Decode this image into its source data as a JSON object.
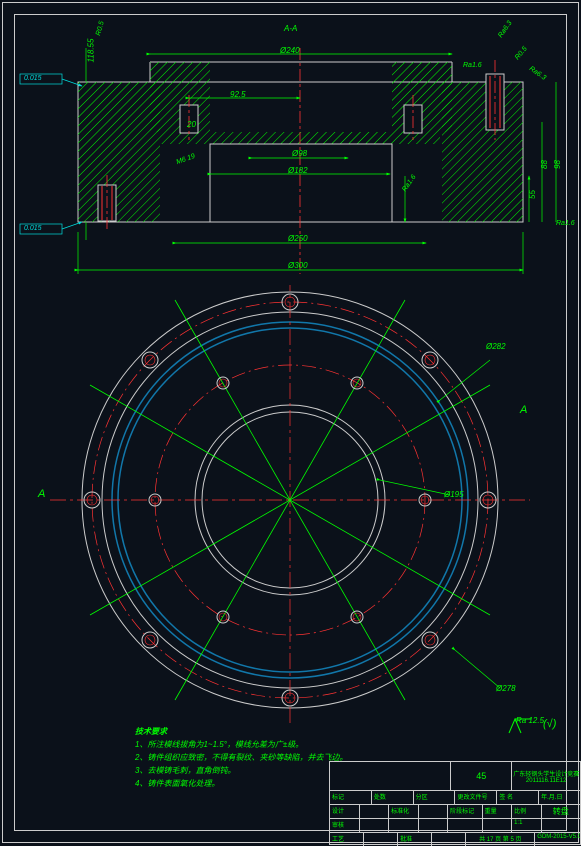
{
  "section_label": "A-A",
  "dims": {
    "d240": "Ø240",
    "d92_5": "92.5",
    "d98": "Ø98",
    "d182": "Ø182",
    "d250": "Ø250",
    "d300": "Ø300",
    "h55": "55",
    "h88": "88",
    "h98": "98",
    "h118_55": "118.55",
    "M6_19": "M6 19",
    "h20": "20",
    "R0_5_L": "R0.5",
    "R0_5_R": "R0.5",
    "Ra1_6_a": "Ra1.6",
    "Ra1_6_b": "Ra1.6",
    "Ra1_6_c": "Ra1.6",
    "Ra6_3": "Ra6.3",
    "Ra6_3b": "Ra6.3",
    "Ra3_2": "Ra3.2",
    "g0_015_75_28": "0.015",
    "g0_015_11_13_12": "0.015",
    "d282": "Ø282",
    "d195": "Ø195",
    "d278": "Ø278"
  },
  "marks": {
    "A1": "A",
    "A2": "A"
  },
  "surf_default": "(√)",
  "surf_val": "Ra 12.5",
  "notes_title": "技术要求",
  "notes": [
    "1、所注模线拔角为1~1.5°，模线允差为广±级。",
    "2、铸件组织应致密，不得有裂纹、夹砂等缺陷，并去飞边。",
    "3、去模铸毛刺，直角倒钝。",
    "4、铸件表面氧化处理。"
  ],
  "titleblock": {
    "material": "45",
    "project_top": "广东轻钢头学生设计竞赛",
    "project_num": "2011116.11E12",
    "dwg_name": "转盘",
    "row_hdr": [
      "标记",
      "处数",
      "分区",
      "更改文件号",
      "签 名",
      "年.月.日"
    ],
    "row_sign1": [
      "设计",
      "",
      "标准化",
      ""
    ],
    "row_sign2": [
      "审核",
      "",
      "",
      ""
    ],
    "row_sign3": [
      "工艺",
      "",
      "批准",
      ""
    ],
    "stage": "阶段标记",
    "weight": "重量",
    "scale": "比例",
    "scale_val": "1:1",
    "sheet": "共 17 页  第 5 页",
    "dwg_no": "GDM-2015-V5.02"
  }
}
